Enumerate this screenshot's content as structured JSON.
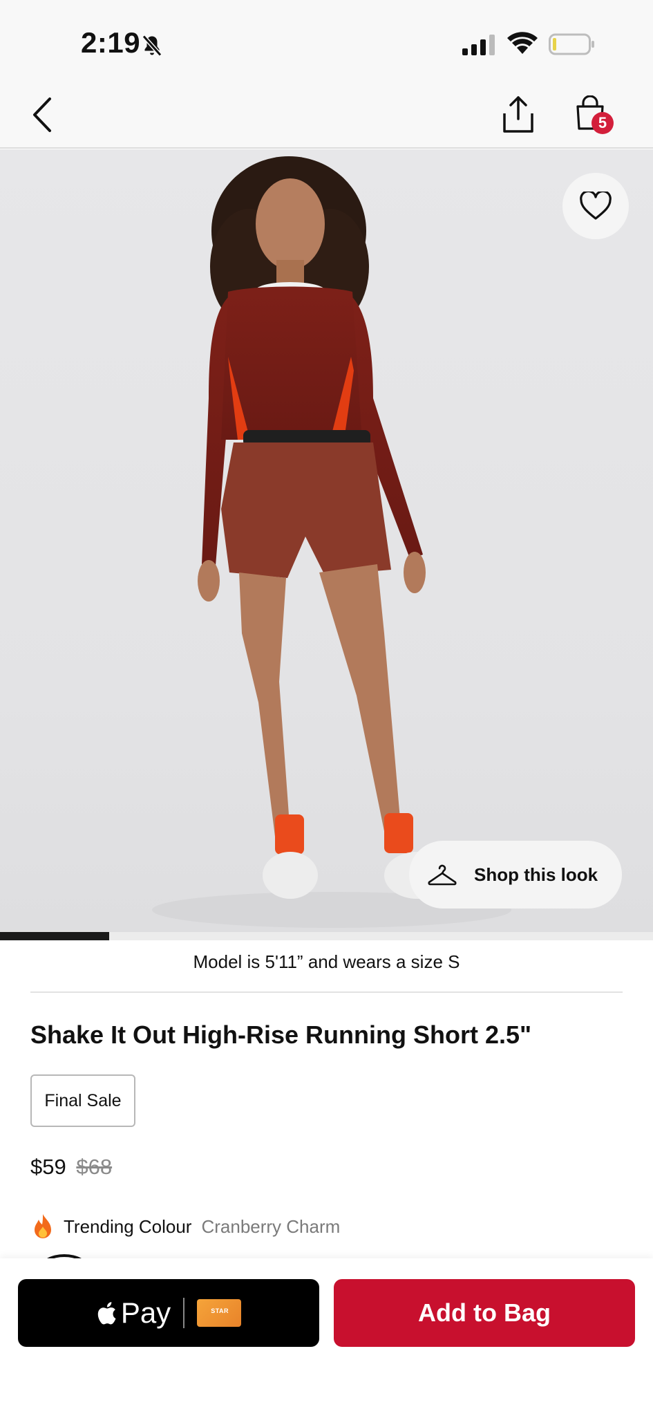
{
  "status_bar": {
    "time": "2:19",
    "icons": [
      "bell-slash-icon",
      "cellular-signal-icon",
      "wifi-icon",
      "battery-low-icon"
    ],
    "battery_color": "#e8d34a"
  },
  "nav": {
    "back_icon": "chevron-left-icon",
    "share_icon": "share-icon",
    "bag_icon": "shopping-bag-icon",
    "bag_count": "5",
    "badge_color": "#d31f3b"
  },
  "hero": {
    "wishlist_icon": "heart-outline-icon",
    "shop_look_icon": "hanger-icon",
    "shop_look_label": "Shop this look",
    "carousel_progress": 0.167
  },
  "product": {
    "model_note": "Model is 5'11” and wears a size S",
    "title": "Shake It Out High-Rise Running Short 2.5\"",
    "badge": "Final Sale",
    "price_now": "$59",
    "price_was": "$68",
    "trend_icon": "flame-icon",
    "trend_label": "Trending Colour",
    "trend_value": "Cranberry Charm"
  },
  "actions": {
    "apple_pay_label": "Pay",
    "apple_icon": "apple-logo-icon",
    "card_text": "STAR",
    "add_to_bag_label": "Add to Bag",
    "accent_color": "#c8102e"
  }
}
